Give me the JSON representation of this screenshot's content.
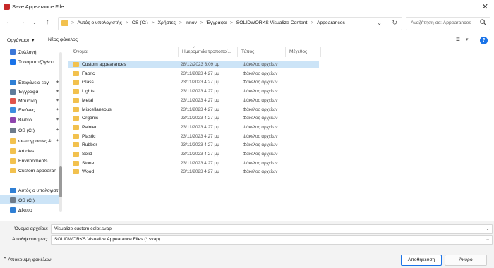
{
  "window": {
    "title": "Save Appearance File",
    "close_glyph": "✕",
    "accent": "#1a73e8",
    "folder_color": "#f2c14e"
  },
  "nav": {
    "back": "←",
    "forward": "→",
    "recent": "⌄",
    "up": "↑",
    "breadcrumbs": [
      ">",
      "Αυτός ο υπολογιστής",
      ">",
      "OS (C:)",
      ">",
      "Χρήστες",
      ">",
      "innov",
      ">",
      "Έγγραφα",
      ">",
      "SOLIDWORKS Visualize Content",
      ">",
      "Appearances"
    ],
    "dropdown": "⌄",
    "refresh": "↻",
    "search_placeholder": "Αναζήτηση σε: Appearances",
    "search_icon": "search-icon"
  },
  "toolbar": {
    "organize": "Οργάνωση ▾",
    "new_folder": "Νέος φάκελος",
    "view_icon": "≡",
    "view_dropdown": "▾",
    "help": "?"
  },
  "sidebar": {
    "items": [
      {
        "label": "Συλλογή",
        "icon": "gallery-icon",
        "color": "#3c78d8",
        "pinned": false
      },
      {
        "label": "Τοσομπατζόγλου",
        "icon": "cloud-icon",
        "color": "#1a73e8",
        "pinned": false
      },
      {
        "label": "Επιφάνεια εργ",
        "icon": "desktop-icon",
        "color": "#2f7fd4",
        "pinned": true
      },
      {
        "label": "Έγγραφα",
        "icon": "documents-icon",
        "color": "#5f7c9a",
        "pinned": true
      },
      {
        "label": "Μουσική",
        "icon": "music-icon",
        "color": "#e0544b",
        "pinned": true
      },
      {
        "label": "Εικόνες",
        "icon": "pictures-icon",
        "color": "#3d8ee0",
        "pinned": true
      },
      {
        "label": "Βίντεο",
        "icon": "videos-icon",
        "color": "#8e44ad",
        "pinned": true
      },
      {
        "label": "OS (C:)",
        "icon": "drive-icon",
        "color": "#6d7b8a",
        "pinned": true
      },
      {
        "label": "Φωτογραφίες & ",
        "icon": "folder-icon",
        "color": "#f2c14e",
        "pinned": true
      },
      {
        "label": "Articles",
        "icon": "folder-icon",
        "color": "#f2c14e",
        "pinned": false
      },
      {
        "label": "Environments",
        "icon": "folder-icon",
        "color": "#f2c14e",
        "pinned": false
      },
      {
        "label": "Custom appearan",
        "icon": "folder-icon",
        "color": "#f2c14e",
        "pinned": false
      },
      {
        "label": "Αυτός ο υπολογιστ",
        "icon": "computer-icon",
        "color": "#2f7fd4",
        "pinned": false
      },
      {
        "label": "OS (C:)",
        "icon": "drive-icon",
        "color": "#6d7b8a",
        "pinned": false
      },
      {
        "label": "Δίκτυο",
        "icon": "network-icon",
        "color": "#2f7fd4",
        "pinned": false
      }
    ],
    "pin_glyph": "📌"
  },
  "list": {
    "headers": {
      "name": "Όνομα",
      "date": "Ημερομηνία τροποποί...",
      "type": "Τύπος",
      "size": "Μέγεθος"
    },
    "sort_arrow": "^",
    "rows": [
      {
        "name": "Custom appearances",
        "date": "28/12/2023 3:09 μμ",
        "type": "Φάκελος αρχείων",
        "selected": true
      },
      {
        "name": "Fabric",
        "date": "23/11/2023 4:27 μμ",
        "type": "Φάκελος αρχείων",
        "selected": false
      },
      {
        "name": "Glass",
        "date": "23/11/2023 4:27 μμ",
        "type": "Φάκελος αρχείων",
        "selected": false
      },
      {
        "name": "Lights",
        "date": "23/11/2023 4:27 μμ",
        "type": "Φάκελος αρχείων",
        "selected": false
      },
      {
        "name": "Metal",
        "date": "23/11/2023 4:27 μμ",
        "type": "Φάκελος αρχείων",
        "selected": false
      },
      {
        "name": "Miscellaneous",
        "date": "23/11/2023 4:27 μμ",
        "type": "Φάκελος αρχείων",
        "selected": false
      },
      {
        "name": "Organic",
        "date": "23/11/2023 4:27 μμ",
        "type": "Φάκελος αρχείων",
        "selected": false
      },
      {
        "name": "Painted",
        "date": "23/11/2023 4:27 μμ",
        "type": "Φάκελος αρχείων",
        "selected": false
      },
      {
        "name": "Plastic",
        "date": "23/11/2023 4:27 μμ",
        "type": "Φάκελος αρχείων",
        "selected": false
      },
      {
        "name": "Rubber",
        "date": "23/11/2023 4:27 μμ",
        "type": "Φάκελος αρχείων",
        "selected": false
      },
      {
        "name": "Solid",
        "date": "23/11/2023 4:27 μμ",
        "type": "Φάκελος αρχείων",
        "selected": false
      },
      {
        "name": "Stone",
        "date": "23/11/2023 4:27 μμ",
        "type": "Φάκελος αρχείων",
        "selected": false
      },
      {
        "name": "Wood",
        "date": "23/11/2023 4:27 μμ",
        "type": "Φάκελος αρχείων",
        "selected": false
      }
    ]
  },
  "footer": {
    "filename_label": "Όνομα αρχείου:",
    "filename_value": "Visualize custom color.svap",
    "savetype_label": "Αποθήκευση ως:",
    "savetype_value": "SOLIDWORKS Visualize Appearance Files (*.svap)",
    "dropdown": "⌄",
    "hide_folders": "Απόκρυψη φακέλων",
    "hide_chevron": "⌃",
    "save": "Αποθήκευση",
    "cancel": "Άκυρο"
  }
}
